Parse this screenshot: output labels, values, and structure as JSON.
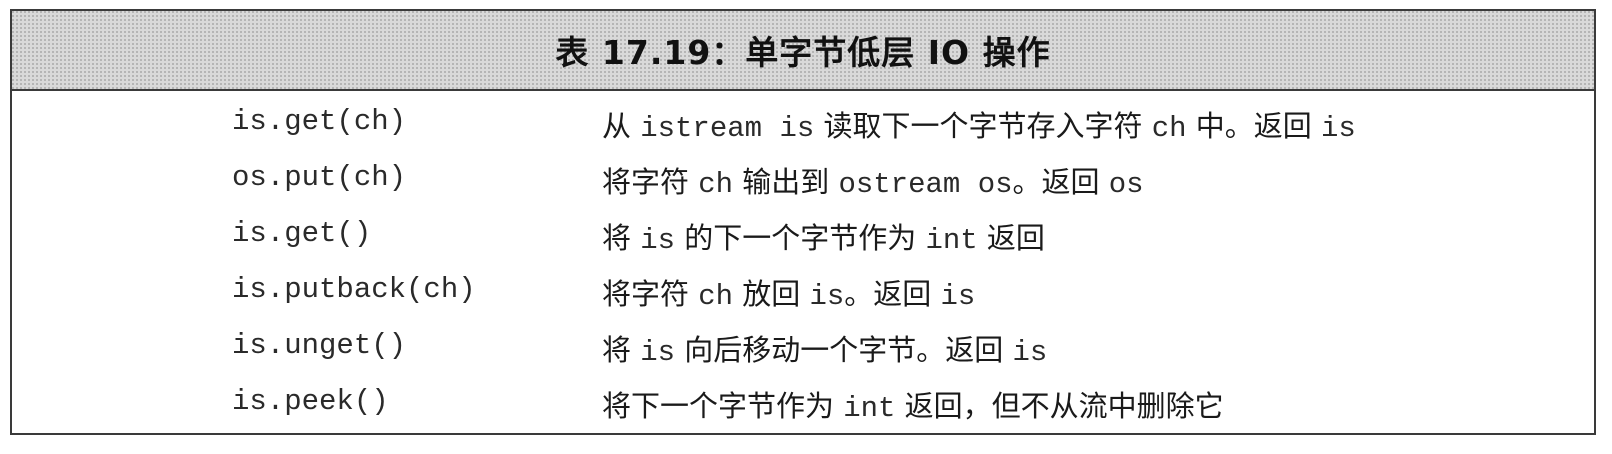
{
  "table": {
    "caption": "表 17.19：单字节低层 IO 操作",
    "rows": [
      {
        "func": "is.get(ch)",
        "desc": [
          {
            "t": "从 "
          },
          {
            "t": "istream is",
            "code": true
          },
          {
            "t": " 读取下一个字节存入字符 "
          },
          {
            "t": "ch",
            "code": true
          },
          {
            "t": " 中。返回 "
          },
          {
            "t": "is",
            "code": true
          }
        ]
      },
      {
        "func": "os.put(ch)",
        "desc": [
          {
            "t": "将字符 "
          },
          {
            "t": "ch",
            "code": true
          },
          {
            "t": " 输出到 "
          },
          {
            "t": "ostream os",
            "code": true
          },
          {
            "t": "。返回 "
          },
          {
            "t": "os",
            "code": true
          }
        ]
      },
      {
        "func": "is.get()",
        "desc": [
          {
            "t": "将 "
          },
          {
            "t": "is",
            "code": true
          },
          {
            "t": " 的下一个字节作为 "
          },
          {
            "t": "int",
            "code": true
          },
          {
            "t": " 返回"
          }
        ]
      },
      {
        "func": "is.putback(ch)",
        "desc": [
          {
            "t": "将字符 "
          },
          {
            "t": "ch",
            "code": true
          },
          {
            "t": " 放回 "
          },
          {
            "t": "is",
            "code": true
          },
          {
            "t": "。返回 "
          },
          {
            "t": "is",
            "code": true
          }
        ]
      },
      {
        "func": "is.unget()",
        "desc": [
          {
            "t": "将 "
          },
          {
            "t": "is",
            "code": true
          },
          {
            "t": " 向后移动一个字节。返回 "
          },
          {
            "t": "is",
            "code": true
          }
        ]
      },
      {
        "func": "is.peek()",
        "desc": [
          {
            "t": "将下一个字节作为 "
          },
          {
            "t": "int",
            "code": true
          },
          {
            "t": " 返回，但不从流中删除它"
          }
        ]
      }
    ]
  }
}
